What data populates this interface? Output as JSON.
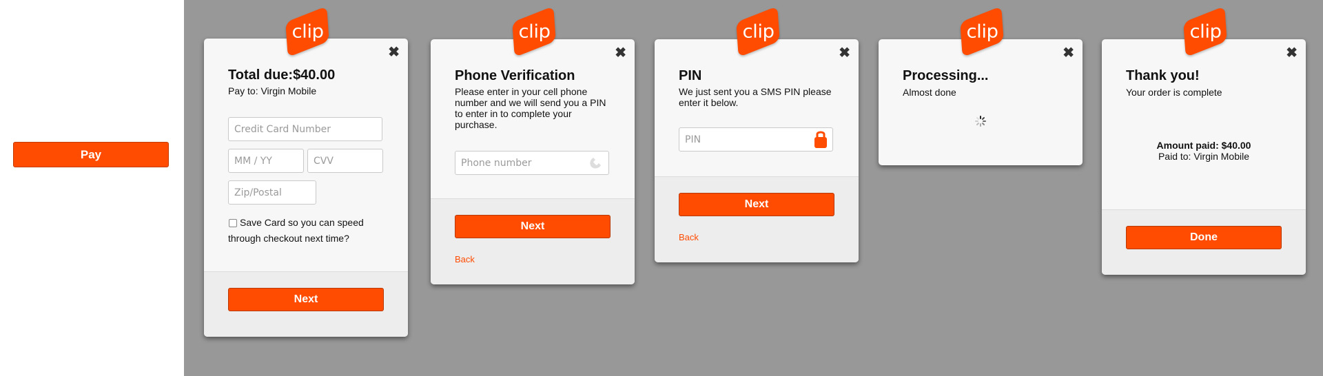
{
  "pay_button": "Pay",
  "logo_text": "clip",
  "close_glyph": "✖",
  "colors": {
    "accent": "#ff4c00",
    "stage": "#989898",
    "card": "#f7f7f7"
  },
  "icons": {
    "phone": "phone-icon",
    "lock": "lock-icon",
    "spinner": "spinner-icon",
    "close": "close-icon"
  },
  "card1": {
    "title": "Total due:$40.00",
    "subtitle": "Pay to: Virgin Mobile",
    "cc_placeholder": "Credit Card Number",
    "exp_placeholder": "MM / YY",
    "cvv_placeholder": "CVV",
    "zip_placeholder": "Zip/Postal",
    "save_card_line1": "Save Card so you can speed",
    "save_card_line2": "through checkout next time?",
    "next": "Next"
  },
  "card2": {
    "title": "Phone Verification",
    "description_lines": [
      "Please enter in your cell phone",
      "number and we will send you a PIN",
      "to enter in to complete your",
      "purchase."
    ],
    "phone_placeholder": "Phone number",
    "next": "Next",
    "back": "Back"
  },
  "card3": {
    "title": "PIN",
    "description_lines": [
      "We just sent you a SMS PIN please",
      "enter it below."
    ],
    "pin_placeholder": "PIN",
    "next": "Next",
    "back": "Back"
  },
  "card4": {
    "title": "Processing...",
    "subtitle": "Almost done"
  },
  "card5": {
    "title": "Thank you!",
    "subtitle": "Your order is complete",
    "amount_paid": "Amount paid: $40.00",
    "paid_to": "Paid to: Virgin Mobile",
    "done": "Done"
  }
}
